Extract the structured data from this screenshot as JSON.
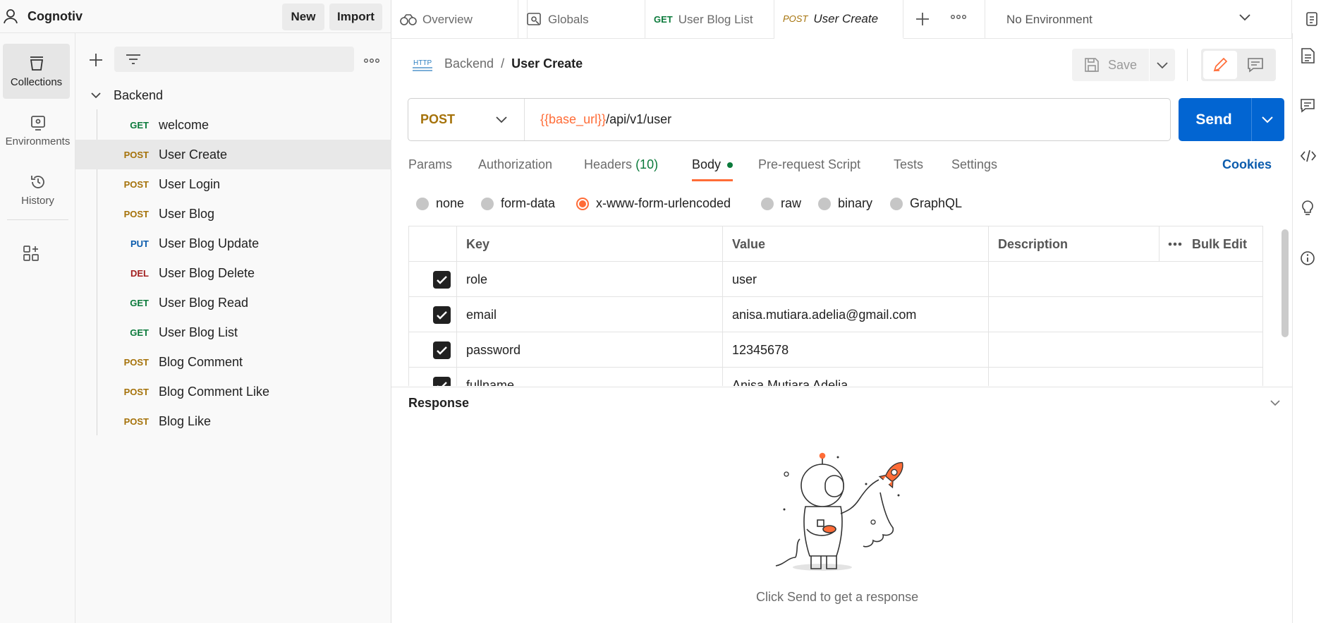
{
  "workspace": {
    "name": "Cognotiv",
    "new_label": "New",
    "import_label": "Import"
  },
  "tabs": [
    {
      "label": "Overview"
    },
    {
      "label": "Globals"
    },
    {
      "method": "GET",
      "label": "User Blog List"
    },
    {
      "method": "POST",
      "label": "User Create"
    }
  ],
  "environment": {
    "selected": "No Environment"
  },
  "rail": [
    {
      "label": "Collections",
      "icon": "collections-icon"
    },
    {
      "label": "Environments",
      "icon": "environments-icon"
    },
    {
      "label": "History",
      "icon": "history-icon"
    }
  ],
  "collection": {
    "folder": "Backend",
    "requests": [
      {
        "method": "GET",
        "name": "welcome"
      },
      {
        "method": "POST",
        "name": "User Create"
      },
      {
        "method": "POST",
        "name": "User Login"
      },
      {
        "method": "POST",
        "name": "User Blog"
      },
      {
        "method": "PUT",
        "name": "User Blog Update"
      },
      {
        "method": "DEL",
        "name": "User Blog Delete"
      },
      {
        "method": "GET",
        "name": "User Blog Read"
      },
      {
        "method": "GET",
        "name": "User Blog List"
      },
      {
        "method": "POST",
        "name": "Blog Comment"
      },
      {
        "method": "POST",
        "name": "Blog Comment Like"
      },
      {
        "method": "POST",
        "name": "Blog Like"
      }
    ]
  },
  "request": {
    "http_badge": "HTTP",
    "breadcrumb_parent": "Backend",
    "breadcrumb_sep": "/",
    "breadcrumb_current": "User Create",
    "save_label": "Save",
    "method": "POST",
    "url_var": "{{base_url}}",
    "url_path": "/api/v1/user",
    "send_label": "Send"
  },
  "subtabs": {
    "params": "Params",
    "authorization": "Authorization",
    "headers": "Headers",
    "headers_count": "(10)",
    "body": "Body",
    "prerequest": "Pre-request Script",
    "tests": "Tests",
    "settings": "Settings",
    "cookies": "Cookies"
  },
  "body_modes": [
    "none",
    "form-data",
    "x-www-form-urlencoded",
    "raw",
    "binary",
    "GraphQL"
  ],
  "body_mode_selected": "x-www-form-urlencoded",
  "table": {
    "headers": {
      "key": "Key",
      "value": "Value",
      "description": "Description",
      "bulk_edit": "Bulk Edit"
    },
    "rows": [
      {
        "checked": true,
        "key": "role",
        "value": "user",
        "description": ""
      },
      {
        "checked": true,
        "key": "email",
        "value": "anisa.mutiara.adelia@gmail.com",
        "description": ""
      },
      {
        "checked": true,
        "key": "password",
        "value": "12345678",
        "description": ""
      },
      {
        "checked": true,
        "key": "fullname",
        "value": "Anisa Mutiara Adelia",
        "description": ""
      }
    ]
  },
  "response": {
    "title": "Response",
    "hint": "Click Send to get a response"
  },
  "colors": {
    "accent": "#ff6c37",
    "send": "#0265d2",
    "get": "#0b7a3b",
    "post": "#a5720a",
    "put": "#0b5cad",
    "del": "#a32020"
  }
}
